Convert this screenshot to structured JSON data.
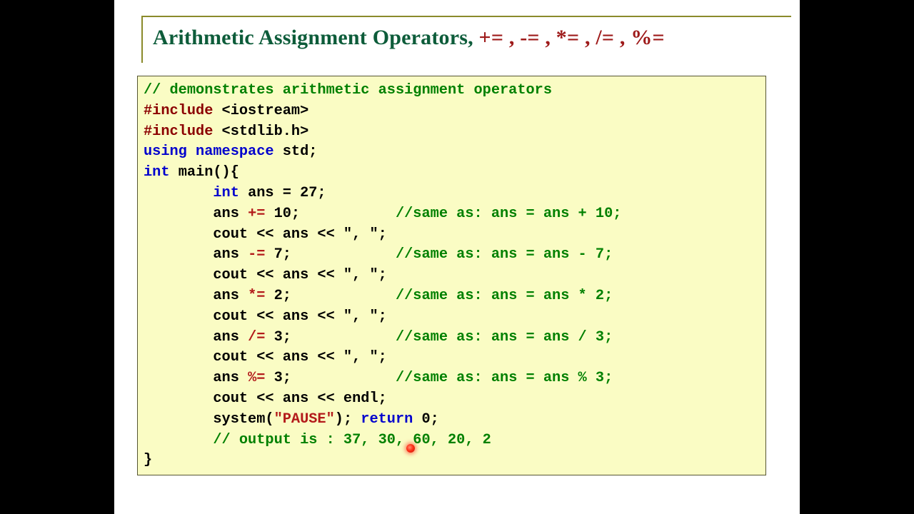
{
  "title": {
    "main": "Arithmetic Assignment Operators, ",
    "ops": "+= , -= , *= , /= , %="
  },
  "code": {
    "l01_comment": "// demonstrates arithmetic assignment operators",
    "l02_pre": "#include ",
    "l02_hdr": "<iostream>",
    "l03_pre": "#include ",
    "l03_hdr": "<stdlib.h>",
    "l04_kw1": "using ",
    "l04_kw2": "namespace ",
    "l04_rest": "std;",
    "l05_kw": "int ",
    "l05_rest": "main(){",
    "l06_kw": "int ",
    "l06_rest": "ans = 27;",
    "l07_a": "ans ",
    "l07_op": "+=",
    "l07_b": " 10;           ",
    "l07_cmt": "//same as: ans = ans + 10;",
    "l08": "cout << ans << \", \";",
    "l09_a": "ans ",
    "l09_op": "-=",
    "l09_b": " 7;            ",
    "l09_cmt": "//same as: ans = ans - 7;",
    "l10": "cout << ans << \", \";",
    "l11_a": "ans ",
    "l11_op": "*=",
    "l11_b": " 2;            ",
    "l11_cmt": "//same as: ans = ans * 2;",
    "l12": "cout << ans << \", \";",
    "l13_a": "ans ",
    "l13_op": "/=",
    "l13_b": " 3;            ",
    "l13_cmt": "//same as: ans = ans / 3;",
    "l14": "cout << ans << \", \";",
    "l15_a": "ans ",
    "l15_op": "%=",
    "l15_b": " 3;            ",
    "l15_cmt": "//same as: ans = ans % 3;",
    "l16": "cout << ans << endl;",
    "l17_a": "system(",
    "l17_str": "\"PAUSE\"",
    "l17_b": "); ",
    "l17_kw": "return ",
    "l17_c": "0;",
    "l18_cmt": "// output is : 37, 30, 60, 20, 2",
    "l19": "}"
  }
}
